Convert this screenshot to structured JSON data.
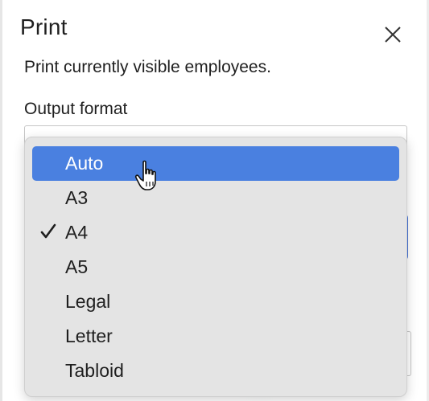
{
  "dialog": {
    "title": "Print",
    "description": "Print currently visible employees.",
    "output_format_label": "Output format"
  },
  "dropdown": {
    "selected_value": "A4",
    "highlighted_value": "Auto",
    "options": [
      {
        "label": "Auto"
      },
      {
        "label": "A3"
      },
      {
        "label": "A4"
      },
      {
        "label": "A5"
      },
      {
        "label": "Legal"
      },
      {
        "label": "Letter"
      },
      {
        "label": "Tabloid"
      }
    ]
  },
  "icons": {
    "close": "close-icon",
    "check": "checkmark-icon",
    "cursor": "hand-pointer-icon"
  },
  "colors": {
    "highlight": "#4a80e0",
    "menu_background": "#e4e4e4",
    "text": "#1f1f1f",
    "accent_button": "#3f6fd6"
  }
}
